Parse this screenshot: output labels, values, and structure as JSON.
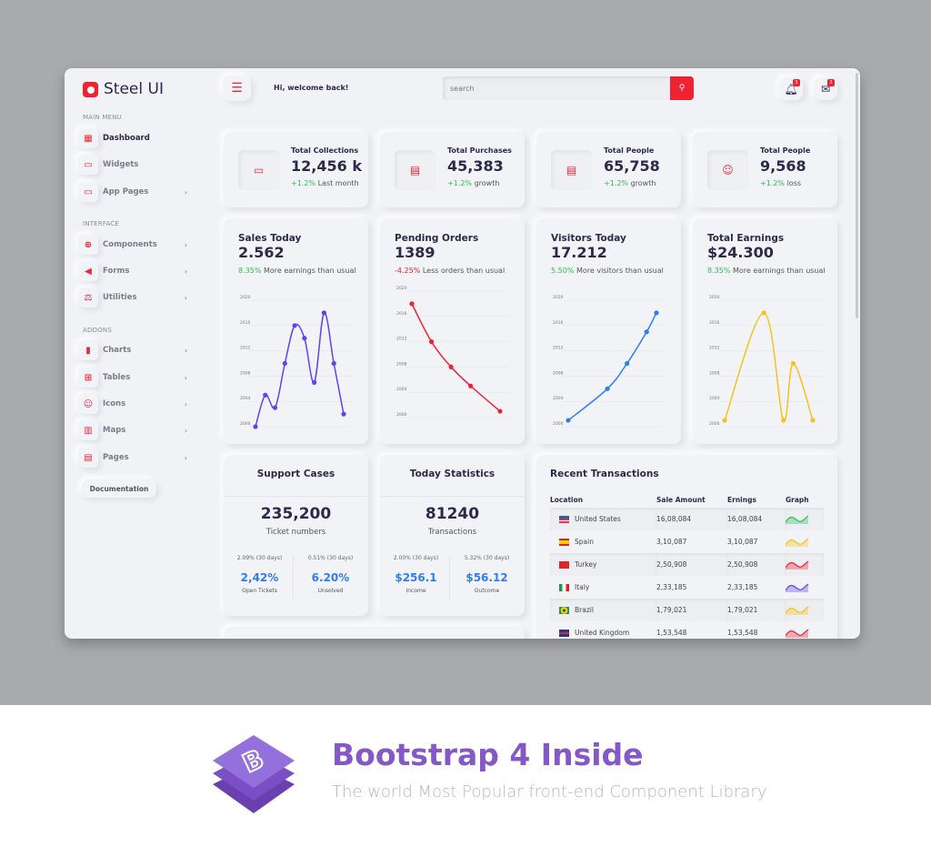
{
  "brand": "Steel UI",
  "header": {
    "welcome": "Hi, welcome back!",
    "search_placeholder": "search",
    "notifications_count": "3",
    "messages_count": "3"
  },
  "sidebar": {
    "sections": [
      "MAIN MENU",
      "INTERFACE",
      "ADDONS"
    ],
    "items": [
      {
        "label": "Dashboard",
        "icon": "dashboard-icon",
        "glyph": "▦",
        "chev": false,
        "active": true
      },
      {
        "label": "Widgets",
        "icon": "monitor-icon",
        "glyph": "▭",
        "chev": false
      },
      {
        "label": "App Pages",
        "icon": "desktop-icon",
        "glyph": "▭",
        "chev": true
      },
      {
        "label": "Components",
        "icon": "crosshair-icon",
        "glyph": "⊕",
        "chev": true
      },
      {
        "label": "Forms",
        "icon": "megaphone-icon",
        "glyph": "◀",
        "chev": true
      },
      {
        "label": "Utilities",
        "icon": "scale-icon",
        "glyph": "⚖",
        "chev": true
      },
      {
        "label": "Charts",
        "icon": "bar-chart-icon",
        "glyph": "▮",
        "chev": true
      },
      {
        "label": "Tables",
        "icon": "table-icon",
        "glyph": "⊞",
        "chev": true
      },
      {
        "label": "Icons",
        "icon": "smile-icon",
        "glyph": "☺",
        "chev": true
      },
      {
        "label": "Maps",
        "icon": "map-icon",
        "glyph": "▥",
        "chev": true
      },
      {
        "label": "Pages",
        "icon": "file-icon",
        "glyph": "▤",
        "chev": true
      }
    ],
    "documentation": "Documentation"
  },
  "stats": [
    {
      "title": "Total Collections",
      "value": "12,456 k",
      "change": "+1.2%",
      "note": "Last month",
      "icon": "folder-icon",
      "glyph": "▭"
    },
    {
      "title": "Total Purchases",
      "value": "45,383",
      "change": "+1.2%",
      "note": "growth",
      "icon": "clipboard-icon",
      "glyph": "▤"
    },
    {
      "title": "Total People",
      "value": "65,758",
      "change": "+1.2%",
      "note": "growth",
      "icon": "document-icon",
      "glyph": "▤"
    },
    {
      "title": "Total People",
      "value": "9,568",
      "change": "+1.2%",
      "note": "loss",
      "icon": "user-icon",
      "glyph": "☺"
    }
  ],
  "chart_data": [
    {
      "type": "line",
      "title": "Sales Today",
      "value": "2.562",
      "change": "8.35%",
      "change_color": "#2fbf4f",
      "note": "More earnings than usual",
      "color": "#5b45f0",
      "x": [
        0,
        1,
        2,
        3,
        4,
        5,
        6,
        7,
        8,
        9
      ],
      "y": [
        2000,
        2005,
        2003,
        2010,
        2016,
        2014,
        2007,
        2018,
        2010,
        2002
      ],
      "ylim": [
        2000,
        2020
      ],
      "yticks": [
        "2020",
        "2016",
        "2012",
        "2008",
        "2004",
        "2000"
      ]
    },
    {
      "type": "line",
      "title": "Pending Orders",
      "value": "1389",
      "change": "-4.25%",
      "change_color": "#ef2233",
      "note": "Less orders than usual",
      "color": "#ef2233",
      "x": [
        0,
        2,
        4,
        6,
        9
      ],
      "y": [
        2018,
        2012,
        2008,
        2005,
        2001
      ],
      "ylim": [
        2000,
        2020
      ],
      "yticks": [
        "2020",
        "2016",
        "2012",
        "2008",
        "2004",
        "2000"
      ]
    },
    {
      "type": "line",
      "title": "Visitors Today",
      "value": "17.212",
      "change": "5.50%",
      "change_color": "#2fbf4f",
      "note": "More visitors than usual",
      "color": "#2f7ef0",
      "x": [
        0,
        4,
        6,
        8,
        9
      ],
      "y": [
        2001,
        2006,
        2010,
        2015,
        2018
      ],
      "ylim": [
        2000,
        2020
      ],
      "yticks": [
        "2020",
        "2016",
        "2012",
        "2008",
        "2004",
        "2000"
      ]
    },
    {
      "type": "line",
      "title": "Total Earnings",
      "value": "$24.300",
      "change": "8.35%",
      "change_color": "#2fbf4f",
      "note": "More earnings than usual",
      "color": "#f7c21b",
      "x": [
        0,
        4,
        6,
        7,
        9
      ],
      "y": [
        2001,
        2018,
        2001,
        2010,
        2001
      ],
      "ylim": [
        2000,
        2020
      ],
      "yticks": [
        "2020",
        "2016",
        "2012",
        "2008",
        "2004",
        "2000"
      ]
    }
  ],
  "support": {
    "title": "Support Cases",
    "value": "235,200",
    "label": "Ticket numbers",
    "left": {
      "period": "2.09% (30 days)",
      "value": "2,42%",
      "label": "Open Tickets"
    },
    "right": {
      "period": "0.51% (30 days)",
      "value": "6.20%",
      "label": "Unsolved"
    }
  },
  "today": {
    "title": "Today Statistics",
    "value": "81240",
    "label": "Transactions",
    "left": {
      "period": "2.00% (30 days)",
      "value": "$256.1",
      "label": "Income"
    },
    "right": {
      "period": "5.32% (30 days)",
      "value": "$56.12",
      "label": "Outcome"
    }
  },
  "transactions": {
    "title": "Recent Transactions",
    "columns": [
      "Location",
      "Sale Amount",
      "Ernings",
      "Graph"
    ],
    "rows": [
      {
        "location": "United States",
        "sale": "16,08,084",
        "earnings": "16,08,084",
        "flag": "us-flag-icon",
        "graph_color": "#2fbf4f"
      },
      {
        "location": "Spain",
        "sale": "3,10,087",
        "earnings": "3,10,087",
        "flag": "spain-flag-icon",
        "graph_color": "#f7c21b"
      },
      {
        "location": "Turkey",
        "sale": "2,50,908",
        "earnings": "2,50,908",
        "flag": "turkey-flag-icon",
        "graph_color": "#ef2233"
      },
      {
        "location": "Italy",
        "sale": "2,33,185",
        "earnings": "2,33,185",
        "flag": "italy-flag-icon",
        "graph_color": "#5b45f0"
      },
      {
        "location": "Brazil",
        "sale": "1,79,021",
        "earnings": "1,79,021",
        "flag": "brazil-flag-icon",
        "graph_color": "#f7c21b"
      },
      {
        "location": "United Kingdom",
        "sale": "1,53,548",
        "earnings": "1,53,548",
        "flag": "uk-flag-icon",
        "graph_color": "#ef2233"
      }
    ]
  },
  "banner": {
    "title": "Bootstrap 4 Inside",
    "subtitle": "The world Most Popular front-end  Component Library",
    "logo_letter": "B"
  },
  "colors": {
    "accent": "#ef2233",
    "positive": "#2fbf4f",
    "blue": "#2f7ef0",
    "bootstrap": "#8458c7"
  }
}
